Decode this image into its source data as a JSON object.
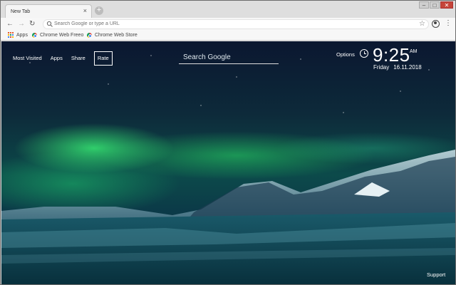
{
  "browser": {
    "tab_title": "New Tab",
    "tab_close": "×",
    "new_tab": "+",
    "omnibox_placeholder": "Search Google or type a URL",
    "bookmarks": [
      {
        "label": "Apps",
        "icon": "apps-grid-icon"
      },
      {
        "label": "Chrome Web Freeo",
        "icon": "chrome-icon"
      },
      {
        "label": "Chrome Web Store",
        "icon": "chrome-icon"
      }
    ]
  },
  "page": {
    "nav": [
      "Most Visited",
      "Apps",
      "Share",
      "Rate"
    ],
    "search_placeholder": "Search Google",
    "options": "Options",
    "time": "9:25",
    "ampm": "AM",
    "day": "Friday",
    "date": "16.11.2018",
    "support": "Support"
  },
  "colors": {
    "aurora": "#3cff78",
    "sky": "#0b1730",
    "water": "#0a2b3a"
  }
}
